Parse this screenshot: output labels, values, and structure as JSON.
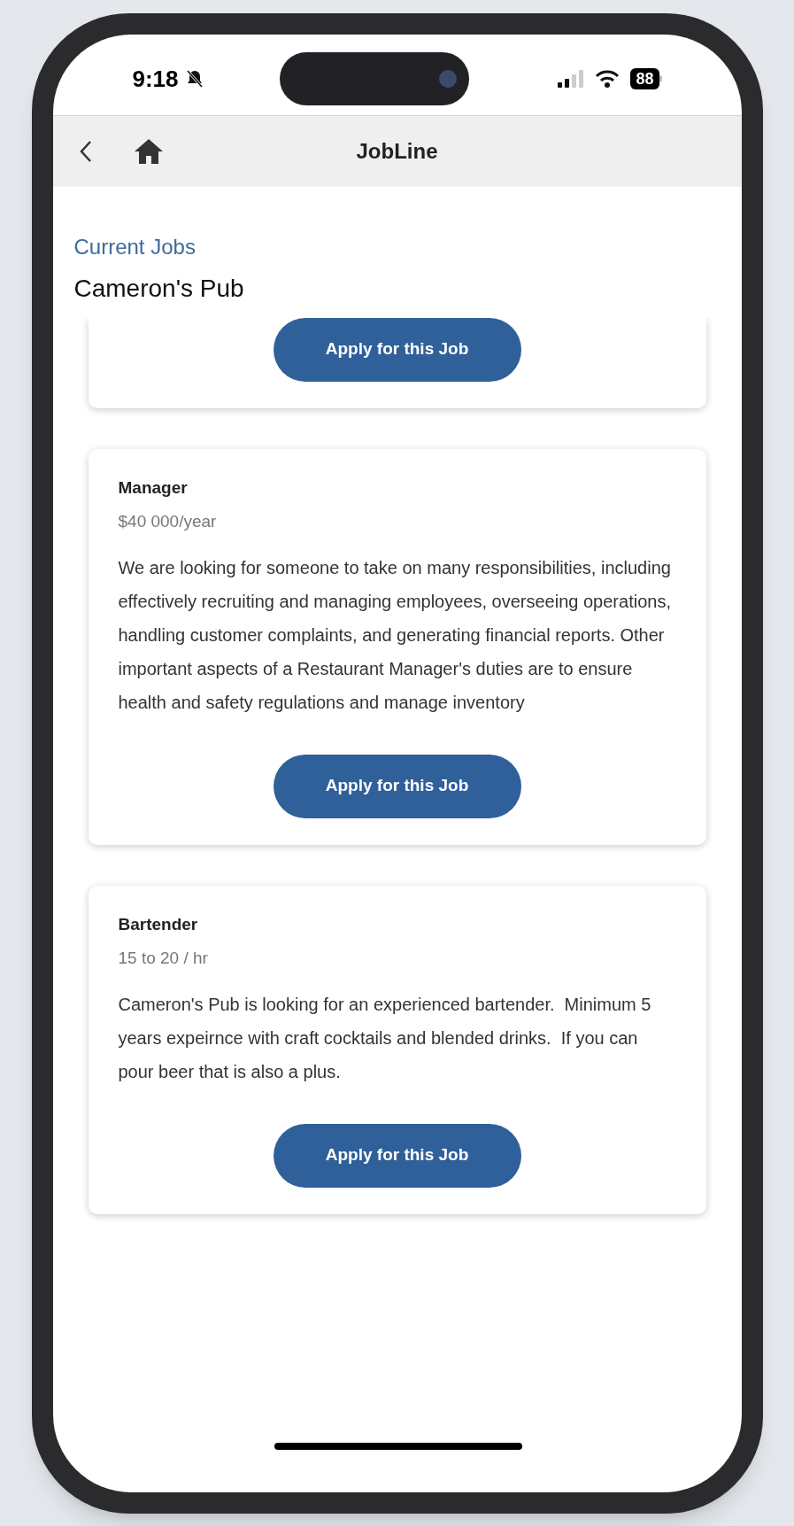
{
  "status_bar": {
    "time": "9:18",
    "battery": "88"
  },
  "nav": {
    "title": "JobLine"
  },
  "header": {
    "section": "Current Jobs",
    "company": "Cameron's Pub"
  },
  "jobs": [
    {
      "button": "Apply for this Job"
    },
    {
      "title": "Manager",
      "pay": "$40 000/year",
      "description": "We are looking for someone to take on many responsibilities, including effectively recruiting and managing employees, overseeing operations, handling customer complaints, and generating financial reports. Other important aspects of a Restaurant Manager's duties are to ensure health and safety regulations and manage inventory",
      "button": "Apply for this Job"
    },
    {
      "title": "Bartender",
      "pay": "15 to 20 / hr",
      "description": "Cameron's Pub is looking for an experienced bartender.  Minimum 5 years expeirnce with craft cocktails and blended drinks.  If you can pour beer that is also a plus.",
      "button": "Apply for this Job"
    }
  ]
}
